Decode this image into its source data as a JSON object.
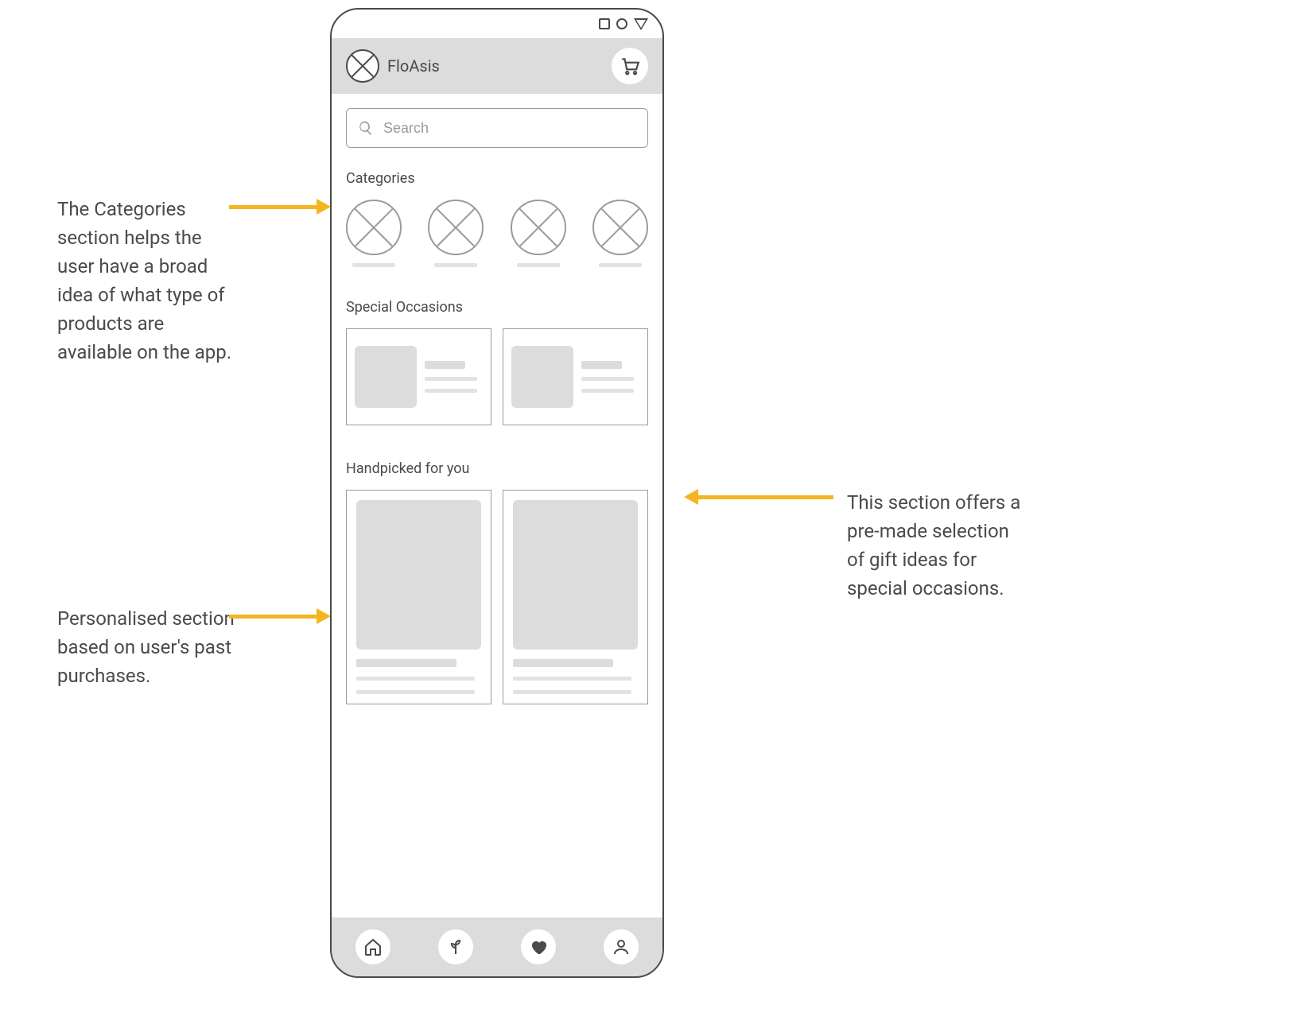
{
  "app_name": "FloAsis",
  "search": {
    "placeholder": "Search"
  },
  "sections": {
    "categories": "Categories",
    "special": "Special Occasions",
    "handpicked": "Handpicked for you"
  },
  "annotations": {
    "categories_note": "The Categories section helps the user have a broad idea of what type of products are available on the app.",
    "handpicked_note": "Personalised section based on user's past purchases.",
    "special_note": "This section offers a pre-made selection of gift ideas for special occasions."
  }
}
